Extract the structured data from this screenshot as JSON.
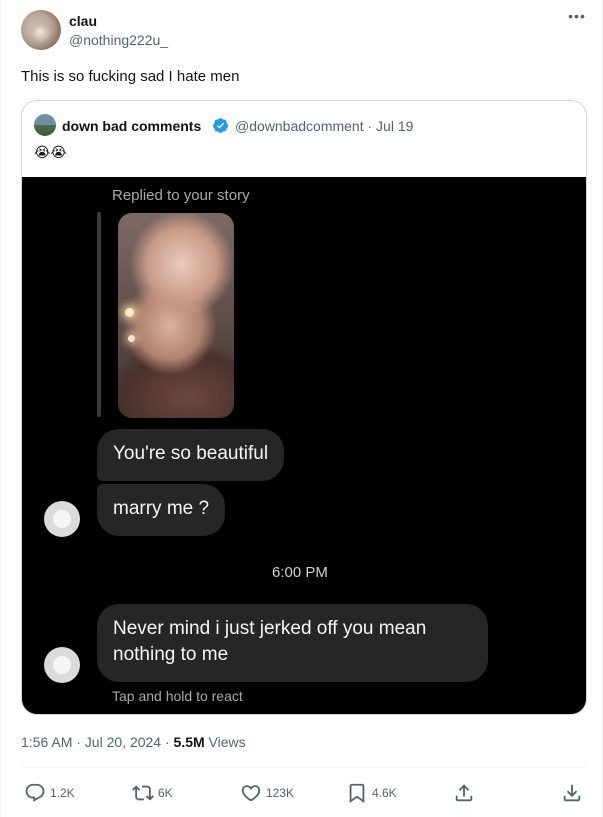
{
  "author": {
    "name": "clau",
    "handle": "@nothing222u_"
  },
  "tweet": {
    "text": "This is so fucking sad I hate men",
    "more_icon": "•••"
  },
  "quote": {
    "name": "down bad comments",
    "meta": "@downbadcomment · Jul 19",
    "emoji": "😭😭",
    "verified_color": "#1d9bf0"
  },
  "dm": {
    "replied_label": "Replied to your story",
    "message_1": "You're so beautiful",
    "message_2": "marry me ?",
    "time": "6:00 PM",
    "message_3": "Never mind i just jerked off you mean nothing to me",
    "hint": "Tap and hold to react"
  },
  "footer": {
    "timestamp": "1:56 AM · Jul 20, 2024 · ",
    "views_count": "5.5M",
    "views_label": " Views"
  },
  "actions": {
    "reply": {
      "icon": "reply-icon",
      "count": "1.2K"
    },
    "retweet": {
      "icon": "retweet-icon",
      "count": "6K"
    },
    "like": {
      "icon": "heart-icon",
      "count": "123K"
    },
    "bookmark": {
      "icon": "bookmark-icon",
      "count": "4.6K"
    },
    "share": {
      "icon": "share-icon"
    },
    "download": {
      "icon": "download-icon"
    }
  }
}
